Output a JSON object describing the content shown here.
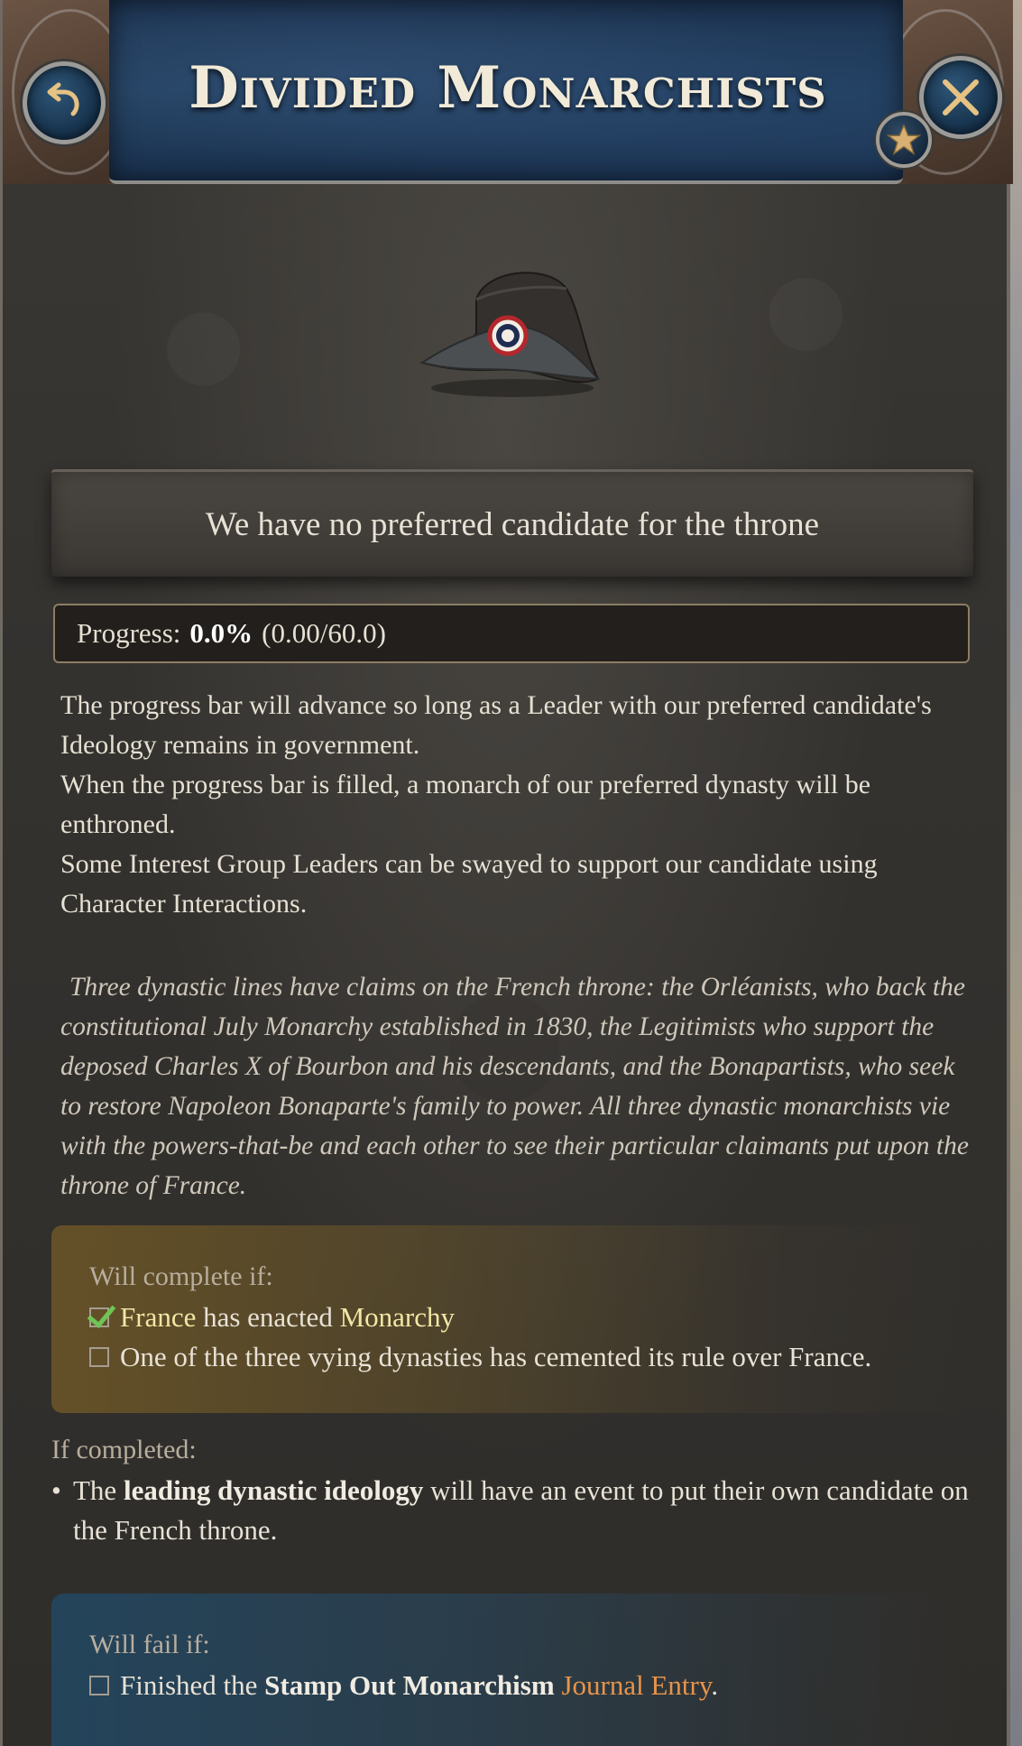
{
  "header": {
    "title": "Divided Monarchists"
  },
  "status": {
    "text": "We have no preferred candidate for the throne"
  },
  "progress": {
    "label": "Progress:",
    "percent_text": "0.0%",
    "ratio_text": "(0.00/60.0)",
    "fraction": 0.0
  },
  "description": {
    "line1": "The progress bar will advance so long as a Leader with our preferred candidate's Ideology remains in government.",
    "line2": "When the progress bar is filled, a monarch of our preferred dynasty will be enthroned.",
    "line3": "Some Interest Group Leaders can be swayed to support our candidate using Character Interactions."
  },
  "flavor_text": "Three dynastic lines have claims on the French throne: the Orléanists, who back the constitutional July Monarchy established in 1830, the Legitimists who support the deposed Charles X of Bourbon and his descendants, and the Bonapartists, who seek to restore Napoleon Bonaparte's family to power. All three dynastic monarchists vie with the powers-that-be and each other to see their particular claimants put upon the throne of France.",
  "will_complete": {
    "heading": "Will complete if:",
    "cond1": {
      "checked": true,
      "country": "France",
      "middle": "has enacted",
      "law": "Monarchy"
    },
    "cond2": {
      "checked": false,
      "text": "One of the three vying dynasties has cemented its rule over France."
    }
  },
  "if_completed": {
    "heading": "If completed:",
    "bullet_symbol": "•",
    "pre": "The",
    "bold": "leading dynastic ideology",
    "post": "will have an event to put their own candidate on the French throne."
  },
  "will_fail": {
    "heading": "Will fail if:",
    "cond1": {
      "checked": false,
      "pre": "Finished the",
      "bold": "Stamp Out Monarchism",
      "link": "Journal Entry",
      "post": "."
    }
  },
  "colors": {
    "accent_yellow": "#f3e7a6",
    "accent_orange": "#e8944a",
    "check_green": "#6fc455",
    "header_blue": "#1d3452"
  },
  "icons": {
    "back": "undo-arrow-icon",
    "close": "close-x-icon",
    "star": "star-icon",
    "illustration": "bicorne-hat-with-cockade"
  }
}
